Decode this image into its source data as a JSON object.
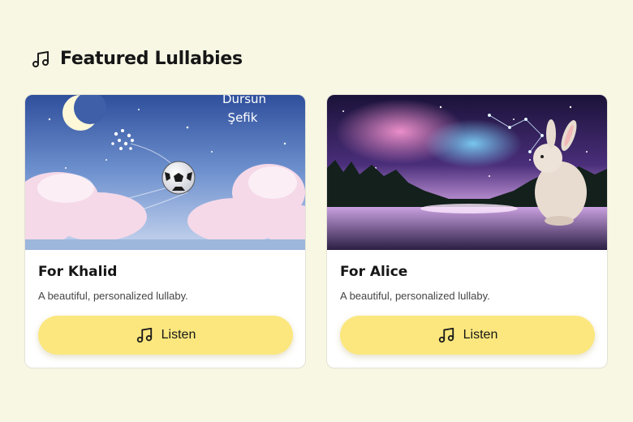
{
  "section": {
    "title": "Featured Lullabies",
    "icon": "music-note-icon"
  },
  "cards": [
    {
      "title": "For Khalid",
      "description": "A beautiful, personalized lullaby.",
      "button_label": "Listen",
      "button_icon": "music-note-icon",
      "art_text_line1": "Dursun",
      "art_text_line2": "Şefik"
    },
    {
      "title": "For Alice",
      "description": "A beautiful, personalized lullaby.",
      "button_label": "Listen",
      "button_icon": "music-note-icon"
    }
  ],
  "colors": {
    "background": "#f8f7e4",
    "button": "#fbe77e",
    "card": "#ffffff"
  }
}
